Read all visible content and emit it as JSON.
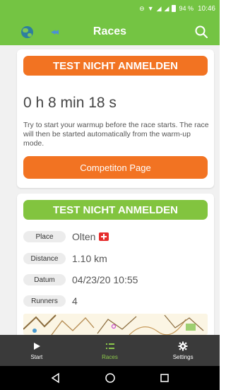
{
  "status_bar": {
    "battery": "94 %",
    "time": "10:46"
  },
  "app_bar": {
    "title": "Races"
  },
  "race_cards": [
    {
      "name": "TEST NICHT ANMELDEN",
      "countdown": "0 h 8 min 18 s",
      "hint": "Try to start your warmup before the race starts. The race will then be started automatically from the warm-up mode.",
      "button_label": "Competiton Page"
    },
    {
      "name": "TEST NICHT ANMELDEN",
      "info": [
        {
          "label": "Place",
          "value": "Olten"
        },
        {
          "label": "Distance",
          "value": "1.10 km"
        },
        {
          "label": "Datum",
          "value": "04/23/20 10:55"
        },
        {
          "label": "Runners",
          "value": "4"
        }
      ]
    }
  ],
  "bottom_nav": [
    {
      "label": "Start",
      "icon": "play-icon"
    },
    {
      "label": "Races",
      "icon": "list-icon",
      "active": true
    },
    {
      "label": "Settings",
      "icon": "gear-icon"
    }
  ],
  "colors": {
    "primary_green": "#74c443",
    "accent_orange": "#f27322",
    "bar_green": "#82c43f",
    "nav_dark": "#3a3a3a"
  }
}
